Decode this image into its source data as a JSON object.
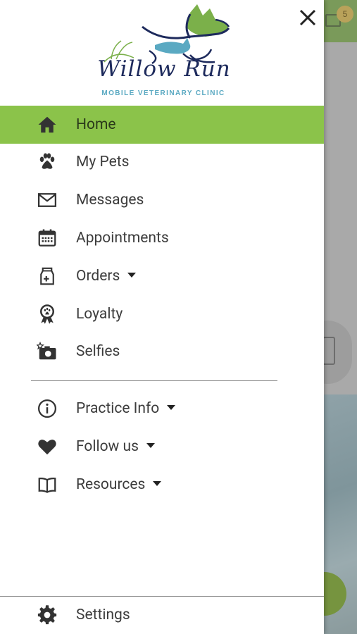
{
  "background": {
    "badge_count": "5"
  },
  "drawer": {
    "logo": {
      "title": "Willow Run",
      "subtitle": "MOBILE VETERINARY CLINIC"
    },
    "items": [
      {
        "label": "Home",
        "icon": "home-icon",
        "active": true
      },
      {
        "label": "My Pets",
        "icon": "paw-icon"
      },
      {
        "label": "Messages",
        "icon": "envelope-icon"
      },
      {
        "label": "Appointments",
        "icon": "calendar-icon"
      },
      {
        "label": "Orders",
        "icon": "food-bag-icon",
        "dropdown": true
      },
      {
        "label": "Loyalty",
        "icon": "award-ribbon-icon"
      },
      {
        "label": "Selfies",
        "icon": "camera-icon"
      }
    ],
    "secondary_items": [
      {
        "label": "Practice Info",
        "icon": "info-icon",
        "dropdown": true
      },
      {
        "label": "Follow us",
        "icon": "heart-icon",
        "dropdown": true
      },
      {
        "label": "Resources",
        "icon": "book-icon",
        "dropdown": true
      }
    ],
    "footer": {
      "label": "Settings",
      "icon": "gear-icon"
    }
  },
  "colors": {
    "accent_green": "#8bc34a",
    "text": "#3c3c3c",
    "logo_navy": "#1d2a5c",
    "logo_teal": "#5aa9c2"
  }
}
